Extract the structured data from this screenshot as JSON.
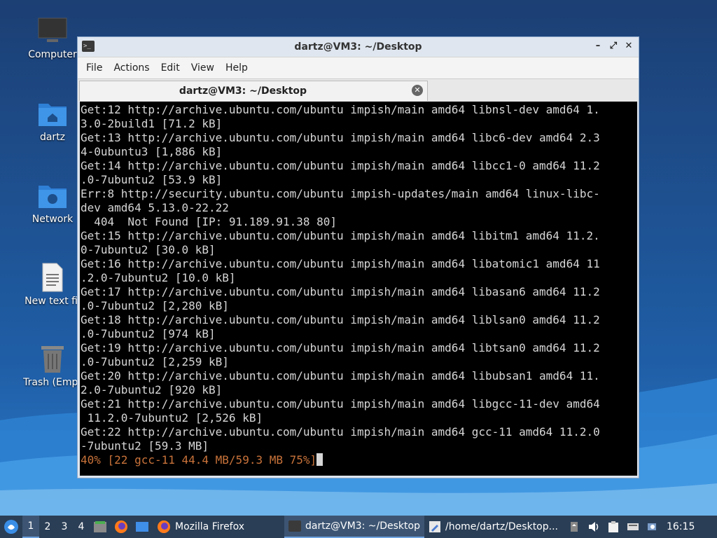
{
  "desktop": {
    "icons": [
      {
        "label": "Computer"
      },
      {
        "label": "dartz"
      },
      {
        "label": "Network"
      },
      {
        "label": "New text fil"
      },
      {
        "label": "Trash (Empt"
      }
    ]
  },
  "window": {
    "title": "dartz@VM3: ~/Desktop",
    "menu": [
      "File",
      "Actions",
      "Edit",
      "View",
      "Help"
    ],
    "tab_label": "dartz@VM3: ~/Desktop"
  },
  "terminal": {
    "lines": [
      "Get:12 http://archive.ubuntu.com/ubuntu impish/main amd64 libnsl-dev amd64 1.",
      "3.0-2build1 [71.2 kB]",
      "Get:13 http://archive.ubuntu.com/ubuntu impish/main amd64 libc6-dev amd64 2.3",
      "4-0ubuntu3 [1,886 kB]",
      "Get:14 http://archive.ubuntu.com/ubuntu impish/main amd64 libcc1-0 amd64 11.2",
      ".0-7ubuntu2 [53.9 kB]",
      "Err:8 http://security.ubuntu.com/ubuntu impish-updates/main amd64 linux-libc-",
      "dev amd64 5.13.0-22.22",
      "  404  Not Found [IP: 91.189.91.38 80]",
      "Get:15 http://archive.ubuntu.com/ubuntu impish/main amd64 libitm1 amd64 11.2.",
      "0-7ubuntu2 [30.0 kB]",
      "Get:16 http://archive.ubuntu.com/ubuntu impish/main amd64 libatomic1 amd64 11",
      ".2.0-7ubuntu2 [10.0 kB]",
      "Get:17 http://archive.ubuntu.com/ubuntu impish/main amd64 libasan6 amd64 11.2",
      ".0-7ubuntu2 [2,280 kB]",
      "Get:18 http://archive.ubuntu.com/ubuntu impish/main amd64 liblsan0 amd64 11.2",
      ".0-7ubuntu2 [974 kB]",
      "Get:19 http://archive.ubuntu.com/ubuntu impish/main amd64 libtsan0 amd64 11.2",
      ".0-7ubuntu2 [2,259 kB]",
      "Get:20 http://archive.ubuntu.com/ubuntu impish/main amd64 libubsan1 amd64 11.",
      "2.0-7ubuntu2 [920 kB]",
      "Get:21 http://archive.ubuntu.com/ubuntu impish/main amd64 libgcc-11-dev amd64",
      " 11.2.0-7ubuntu2 [2,526 kB]",
      "Get:22 http://archive.ubuntu.com/ubuntu impish/main amd64 gcc-11 amd64 11.2.0",
      "-7ubuntu2 [59.3 MB]"
    ],
    "progress_line": "40% [22 gcc-11 44.4 MB/59.3 MB 75%]"
  },
  "taskbar": {
    "workspaces": [
      "1",
      "2",
      "3",
      "4"
    ],
    "active_workspace": "1",
    "tasks": [
      {
        "label": "Mozilla Firefox",
        "icon": "firefox-icon"
      },
      {
        "label": "dartz@VM3: ~/Desktop",
        "icon": "terminal-icon"
      },
      {
        "label": "/home/dartz/Desktop...",
        "icon": "text-editor-icon"
      }
    ],
    "clock": "16:15"
  },
  "colors": {
    "terminal_bg": "#000000",
    "terminal_fg": "#d6d6d6",
    "progress_fg": "#c9733a",
    "taskbar_bg": "#2a3e56"
  }
}
